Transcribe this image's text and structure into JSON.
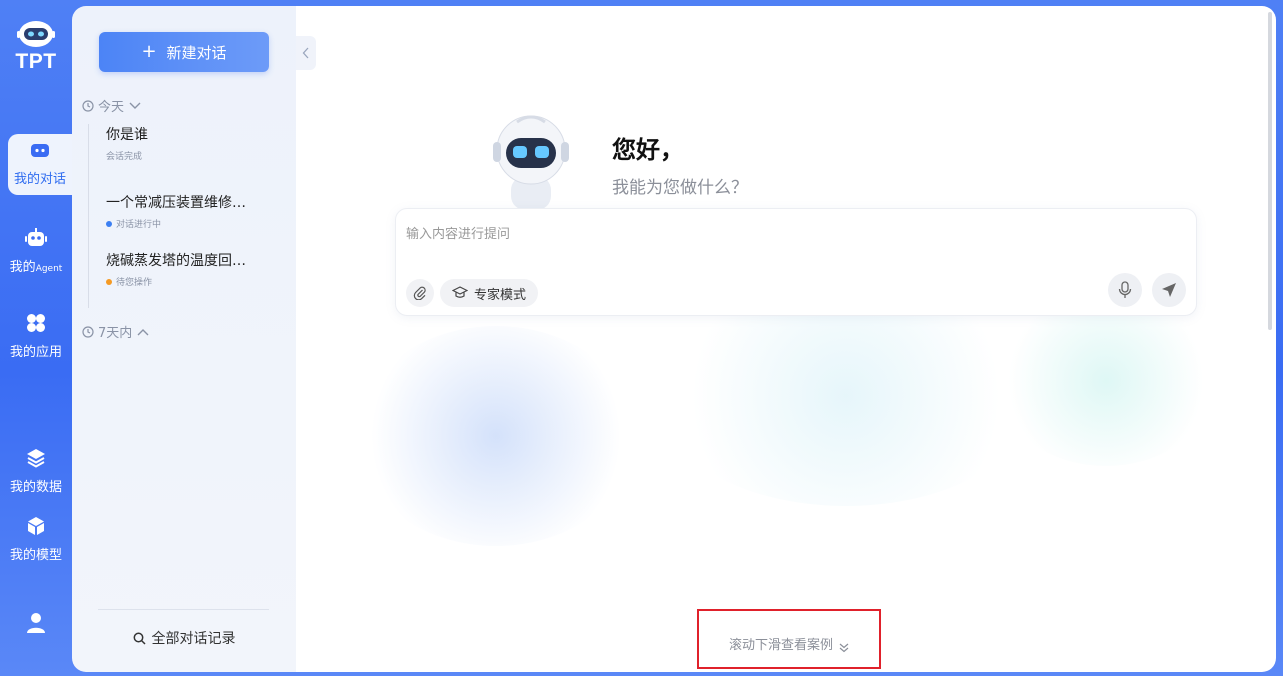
{
  "app": {
    "logo_text": "TPT"
  },
  "rail": {
    "items": [
      {
        "label": "我的对话",
        "icon": "chat-bot-icon",
        "active": true
      },
      {
        "label_main": "我的",
        "label_small": "Agent",
        "icon": "robot-icon"
      },
      {
        "label": "我的应用",
        "icon": "apps-icon"
      },
      {
        "label": "我的数据",
        "icon": "layers-icon"
      },
      {
        "label": "我的模型",
        "icon": "cube-icon"
      }
    ],
    "user_icon": "user-icon"
  },
  "sidebar": {
    "new_chat_label": "新建对话",
    "groups": [
      {
        "label": "今天",
        "expanded": true
      },
      {
        "label": "7天内",
        "expanded": false
      }
    ],
    "conversations": [
      {
        "title": "你是谁",
        "status": "会话完成",
        "status_color": ""
      },
      {
        "title": "一个常减压装置维修…",
        "status": "对话进行中",
        "status_color": "#3b7ff2"
      },
      {
        "title": "烧碱蒸发塔的温度回…",
        "status": "待您操作",
        "status_color": "#f59a23"
      }
    ],
    "all_history_label": "全部对话记录"
  },
  "main": {
    "greeting_title": "您好，",
    "greeting_sub": "我能为您做什么？",
    "input_placeholder": "输入内容进行提问",
    "expert_mode_label": "专家模式",
    "scroll_hint": "滚动下滑查看案例"
  },
  "colors": {
    "accent": "#3a6cf3",
    "highlight_border": "#e0212b"
  }
}
